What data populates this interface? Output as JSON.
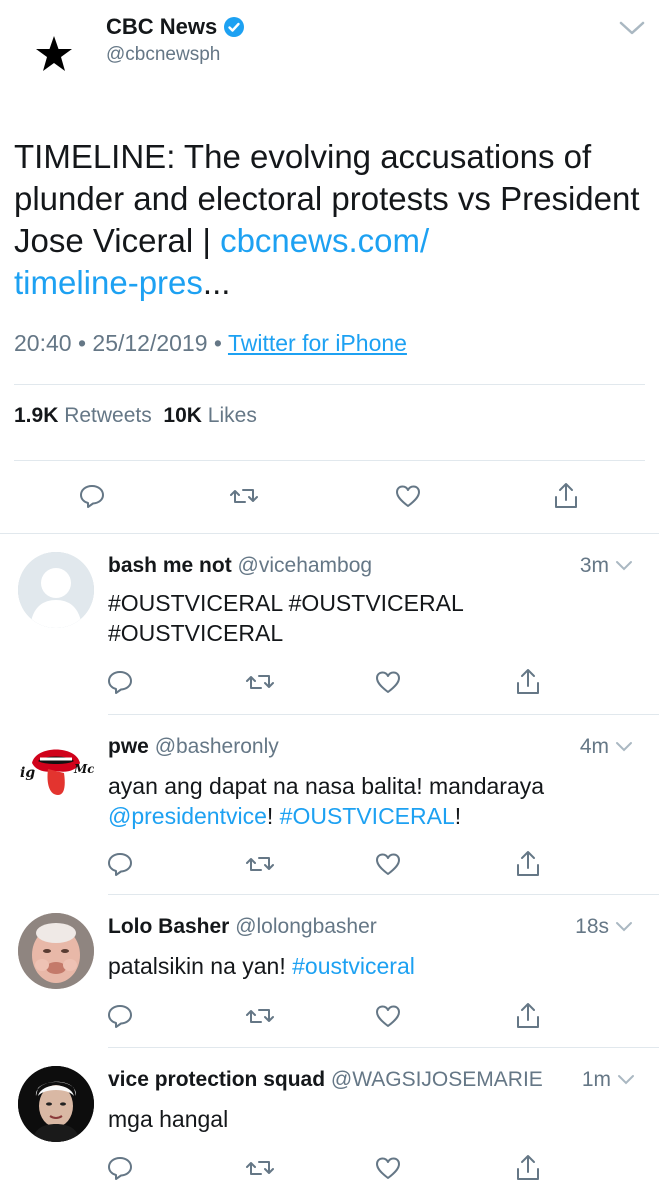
{
  "main_tweet": {
    "display_name": "CBC News",
    "handle": "@cbcnewsph",
    "text_plain": "TIMELINE: The evolving accusations of plunder and electoral protests vs President Jose Viceral | ",
    "link_part1": "cbcnews.com/",
    "link_part2": "timeline-pres",
    "link_ellipsis": "...",
    "time": "20:40",
    "date": "25/12/2019",
    "separator": "•",
    "source": "Twitter for iPhone",
    "retweets_count": "1.9K",
    "retweets_label": "Retweets",
    "likes_count": "10K",
    "likes_label": "Likes"
  },
  "replies": [
    {
      "name": "bash me not",
      "handle": "@vicehambog",
      "time": "3m",
      "line1": "#OUSTVICERAL #OUSTVICERAL",
      "line2": "#OUSTVICERAL"
    },
    {
      "name": "pwe",
      "handle": "@basheronly",
      "time": "4m",
      "line1": "ayan ang dapat na nasa balita! mandaraya",
      "mention": "@presidentvice",
      "bang1": "! ",
      "hashtag": "#OUSTVICERAL",
      "bang2": "!"
    },
    {
      "name": "Lolo Basher",
      "handle": "@lolongbasher",
      "time": "18s",
      "text": "patalsikin na yan! ",
      "hashtag": "#oustviceral"
    },
    {
      "name": "vice protection squad",
      "handle": "@WAGSIJOSEMARIE",
      "time": "1m",
      "text": "mga hangal"
    }
  ],
  "colors": {
    "link_blue": "#1da1f2",
    "gray_text": "#657786",
    "divider": "#e1e8ed",
    "verified": "#1da1f2"
  },
  "icons": [
    "star-logo-icon",
    "verified-badge-icon",
    "chevron-down-icon",
    "reply-icon",
    "retweet-icon",
    "like-icon",
    "share-icon",
    "default-avatar-icon"
  ]
}
